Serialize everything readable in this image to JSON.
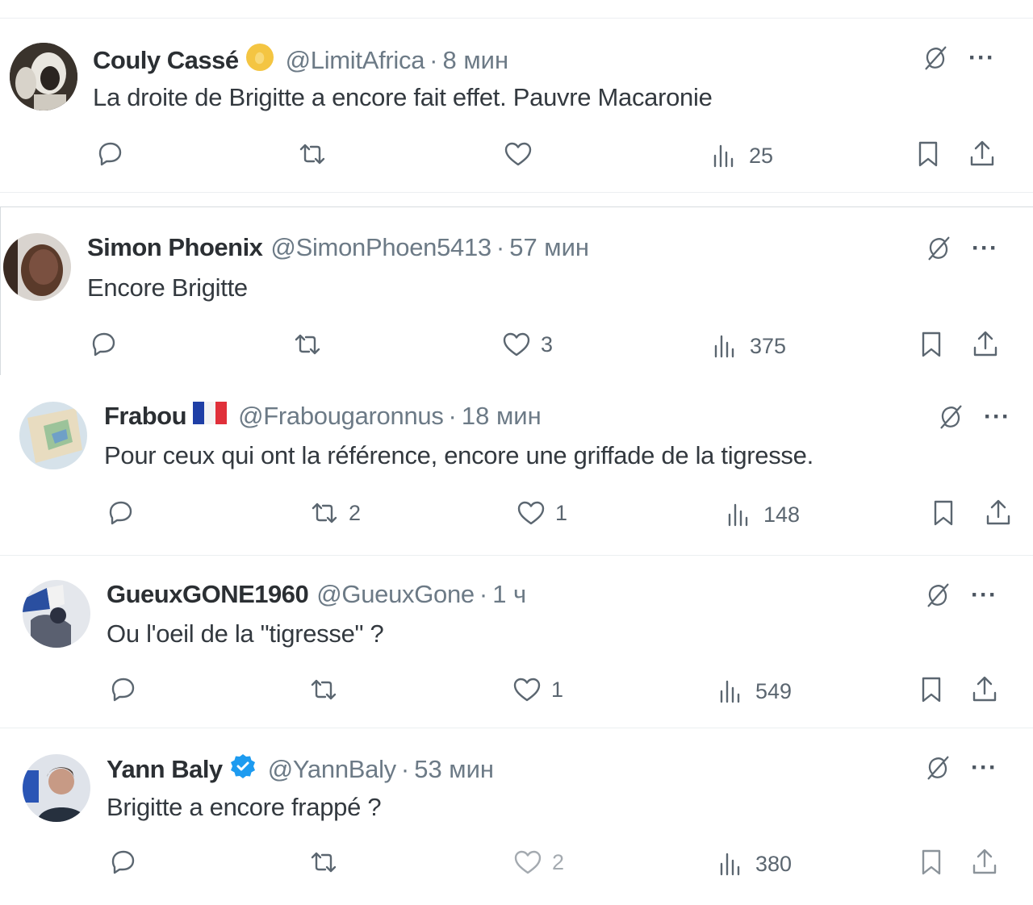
{
  "tweets": [
    {
      "author": "Couly Cassé",
      "badge": "gold",
      "handle": "@LimitAfrica",
      "time": "8 мин",
      "text": "La droite de Brigitte a encore fait effet. Pauvre Macaronie",
      "stats": {
        "replies": "",
        "retweets": "",
        "likes": "",
        "views": "25"
      }
    },
    {
      "author": "Simon Phoenix",
      "badge": "",
      "handle": "@SimonPhoen5413",
      "time": "57 мин",
      "text": "Encore Brigitte",
      "stats": {
        "replies": "",
        "retweets": "",
        "likes": "3",
        "views": "375"
      }
    },
    {
      "author": "Frabou",
      "badge": "flag-fr",
      "handle": "@Frabougaronnus",
      "time": "18 мин",
      "text": "Pour ceux qui ont la référence, encore une griffade de la tigresse.",
      "stats": {
        "replies": "",
        "retweets": "2",
        "likes": "1",
        "views": "148"
      }
    },
    {
      "author": "GueuxGONE1960",
      "badge": "",
      "handle": "@GueuxGone",
      "time": "1 ч",
      "text": "Ou l'oeil de la \"tigresse\" ?",
      "stats": {
        "replies": "",
        "retweets": "",
        "likes": "1",
        "views": "549"
      }
    },
    {
      "author": "Yann Baly",
      "badge": "blue-verified",
      "handle": "@YannBaly",
      "time": "53 мин",
      "text": "Brigitte a encore frappé ?",
      "stats": {
        "replies": "",
        "retweets": "",
        "likes": "2",
        "views": "380"
      }
    }
  ],
  "dot": "·",
  "more": "···",
  "icons": {
    "reply": "reply-icon",
    "retweet": "retweet-icon",
    "like": "heart-icon",
    "views": "views-icon",
    "bookmark": "bookmark-icon",
    "share": "share-icon",
    "grok": "grok-icon"
  },
  "colors": {
    "text_secondary": "#536471",
    "gold_badge": "#f4c542",
    "verified_blue": "#1d9bf0"
  }
}
